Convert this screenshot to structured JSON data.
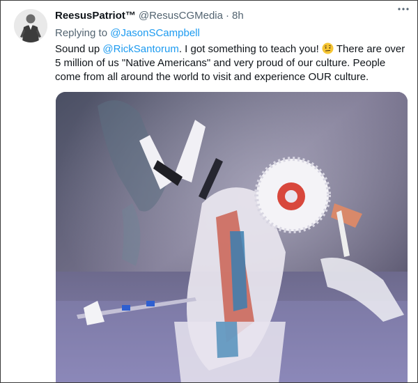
{
  "tweet": {
    "display_name": "ReesusPatriot™",
    "handle": "@ResusCGMedia",
    "separator": "·",
    "time": "8h",
    "replying_label": "Replying to",
    "replying_to": "@JasonSCampbell",
    "text_before_mention": "Sound up ",
    "mention": "@RickSantorum",
    "text_after_mention": ". I got something to teach you!",
    "text_after_emoji": " There are over 5 million of us \"Native Americans\" and very proud of our culture. People come from all around the world to visit and experience OUR culture.",
    "emoji_icon": "face-with-raised-eyebrow-icon",
    "more_icon": "more-horizontal-icon"
  },
  "colors": {
    "accent": "#1d9bf0",
    "secondary_text": "#536471",
    "primary_text": "#0f1419",
    "frame_border": "#3a3a3a"
  }
}
